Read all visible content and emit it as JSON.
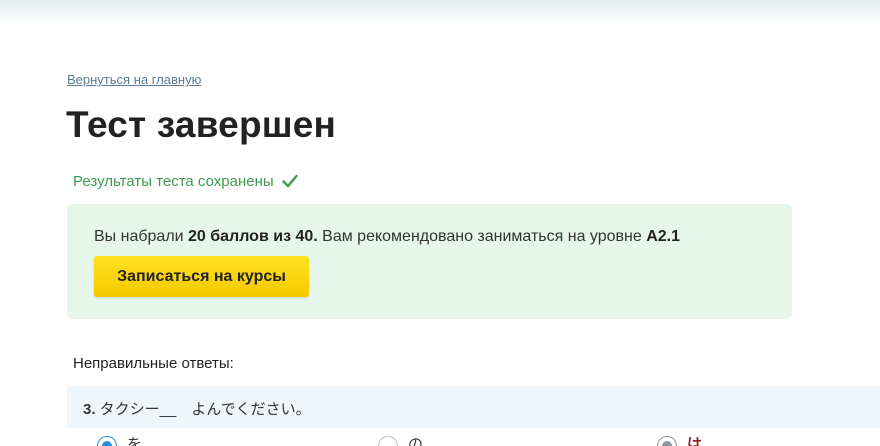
{
  "nav": {
    "back_link": "Вернуться на главную"
  },
  "page": {
    "title": "Тест завершен"
  },
  "status": {
    "saved_text": "Результаты теста сохранены",
    "saved_icon": "checkmark-icon",
    "saved_color": "#3c9a52"
  },
  "result": {
    "prefix": "Вы набрали ",
    "score": "20 баллов из 40.",
    "middle": " Вам рекомендовано заниматься на уровне ",
    "level": "A2.1",
    "box_color": "#e6f6ea",
    "enroll_button": "Записаться на курсы",
    "button_color": "#f5c800"
  },
  "wrong_answers": {
    "label": "Неправильные ответы:",
    "questions": [
      {
        "number": "3.",
        "text": " タクシー__　よんでください。",
        "options": [
          {
            "label": "を",
            "state": "correct-selected"
          },
          {
            "label": "の",
            "state": "unselected"
          },
          {
            "label": "は",
            "state": "wrong-selected"
          }
        ]
      }
    ]
  }
}
